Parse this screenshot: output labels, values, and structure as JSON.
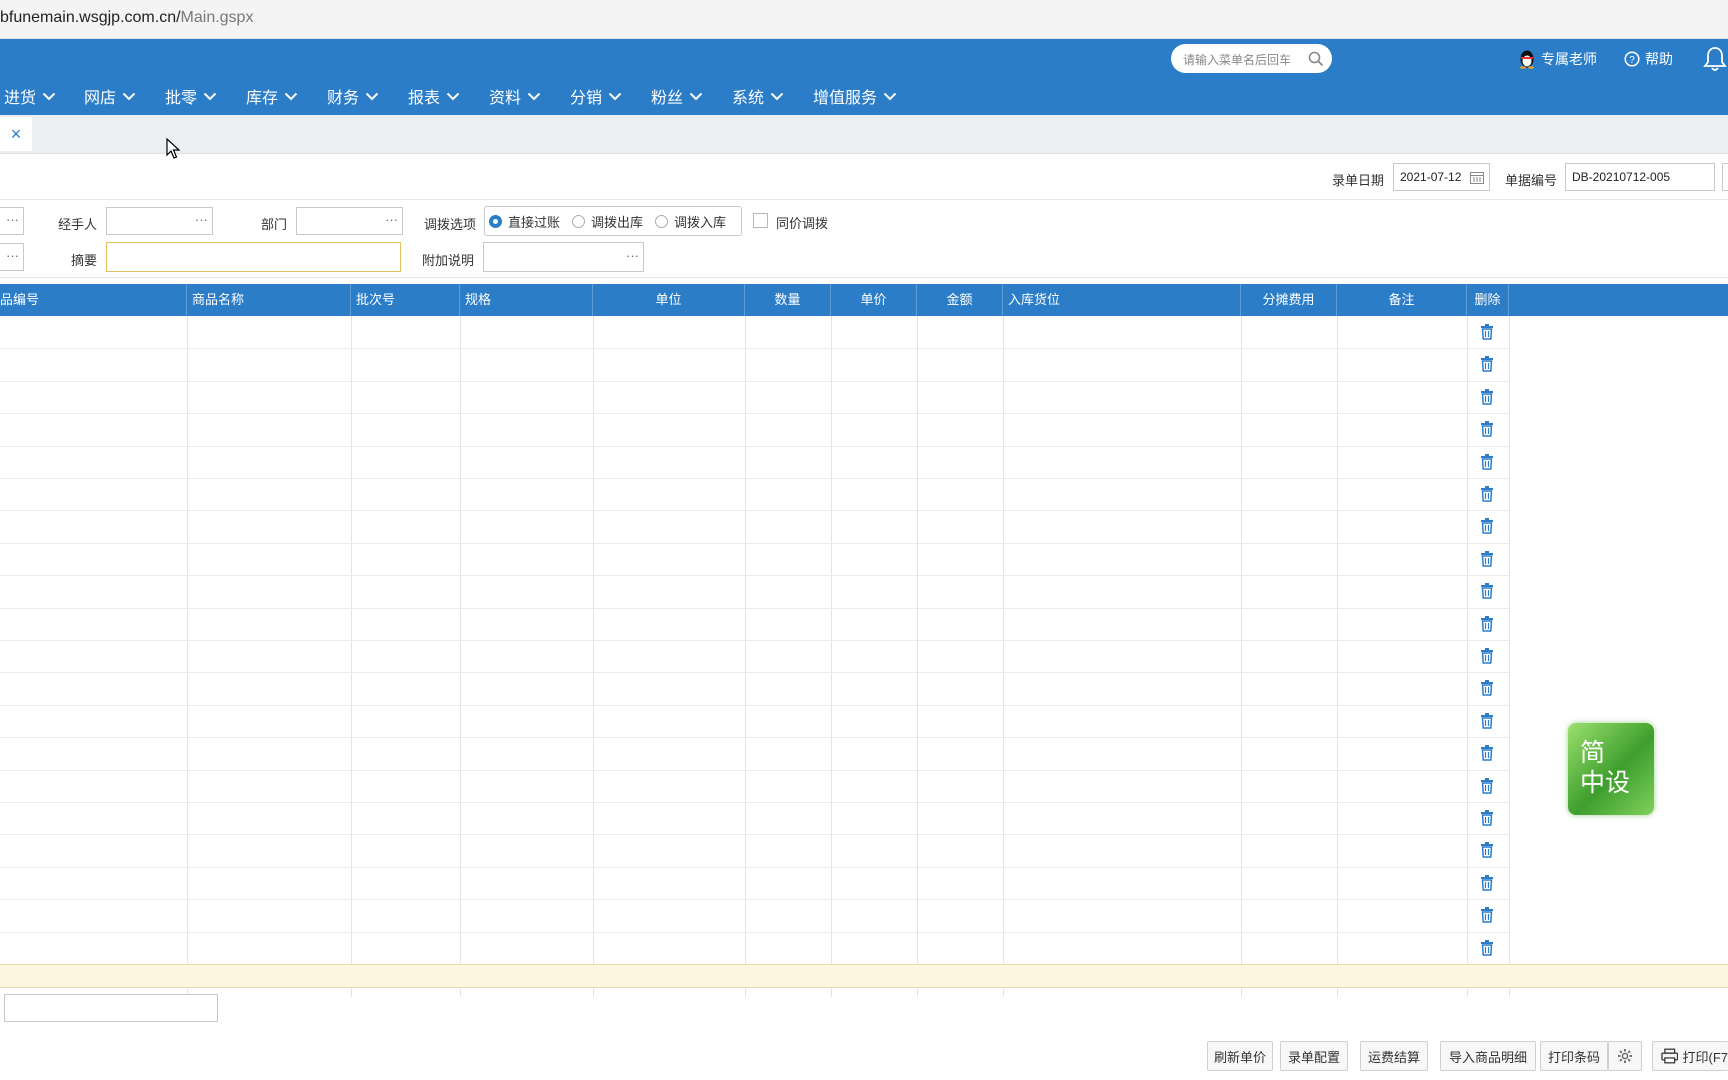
{
  "browser": {
    "url_host": "bfunemain.wsgjp.com.cn/",
    "url_path": "Main.gspx"
  },
  "header": {
    "search_placeholder": "请输入菜单名后回车",
    "teacher_label": "专属老师",
    "help_label": "帮助",
    "nav": [
      "进货",
      "网店",
      "批零",
      "库存",
      "财务",
      "报表",
      "资料",
      "分销",
      "粉丝",
      "系统",
      "增值服务"
    ]
  },
  "tabbar": {
    "close_glyph": "×"
  },
  "form": {
    "date_label": "录单日期",
    "date_value": "2021-07-12",
    "docno_label": "单据编号",
    "docno_value": "DB-20210712-005",
    "handler_label": "经手人",
    "dept_label": "部门",
    "transfer_label": "调拨选项",
    "radio_options": [
      {
        "label": "直接过账",
        "checked": true
      },
      {
        "label": "调拨出库",
        "checked": false
      },
      {
        "label": "调拨入库",
        "checked": false
      }
    ],
    "same_price_label": "同价调拨",
    "summary_label": "摘要",
    "extra_label": "附加说明",
    "dots": "···"
  },
  "grid": {
    "columns": [
      "品编号",
      "商品名称",
      "批次号",
      "规格",
      "单位",
      "数量",
      "单价",
      "金额",
      "入库货位",
      "分摊费用",
      "备注",
      "删除"
    ],
    "row_count": 20
  },
  "footer": {
    "buttons": [
      "刷新单价",
      "录单配置",
      "运费结算",
      "导入商品明细",
      "打印条码",
      "打印(F7"
    ]
  },
  "badge": {
    "text_1": "简",
    "text_2": "中设"
  },
  "colors": {
    "primary": "#2b7dc8",
    "trash": "#2b7dc8",
    "summary_row": "#fdf6df"
  }
}
